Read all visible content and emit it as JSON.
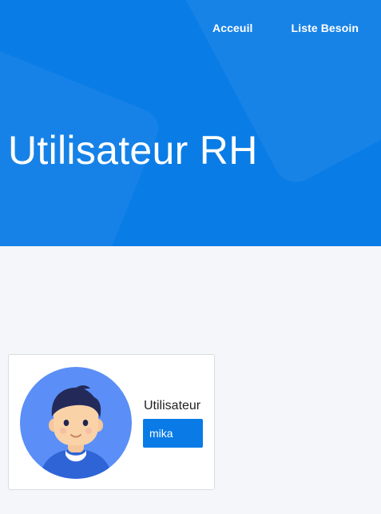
{
  "nav": {
    "items": [
      {
        "label": "Acceuil"
      },
      {
        "label": "Liste Besoin"
      }
    ]
  },
  "hero": {
    "title": "Utilisateur RH"
  },
  "profile": {
    "label": "Utilisateur",
    "value": "mika",
    "avatar_icon": "user-avatar-icon"
  },
  "colors": {
    "primary": "#0a7ce6",
    "page_bg": "#f5f6fa",
    "card_border": "#d9dde3"
  }
}
